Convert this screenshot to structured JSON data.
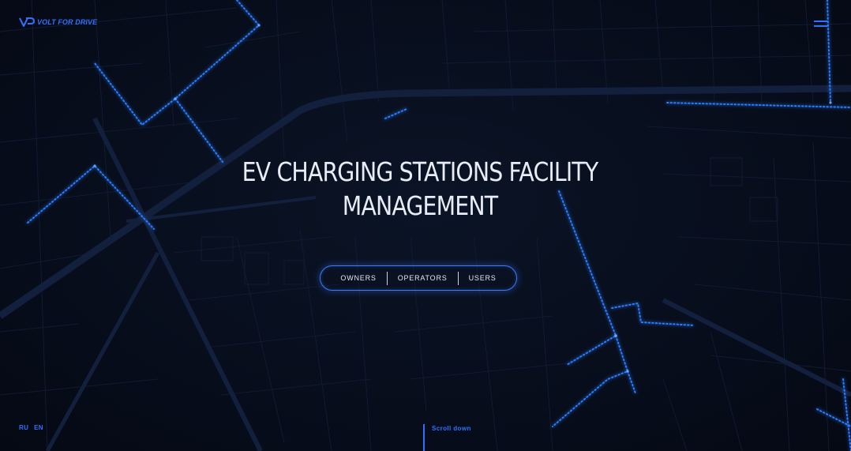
{
  "brand": {
    "name": "VOLT FOR DRIVE",
    "accent_color": "#2f72ff"
  },
  "header": {
    "menu_icon": "hamburger-menu-icon"
  },
  "hero": {
    "title_line1": "EV CHARGING STATIONS FACILITY",
    "title_line2": "MANAGEMENT"
  },
  "audience_switch": {
    "options": [
      "OWNERS",
      "OPERATORS",
      "USERS"
    ]
  },
  "languages": [
    "RU",
    "EN"
  ],
  "scroll_hint": "Scroll down",
  "background": {
    "type": "dark city map with glowing blue charging routes",
    "glow_color": "#2a7bff"
  }
}
